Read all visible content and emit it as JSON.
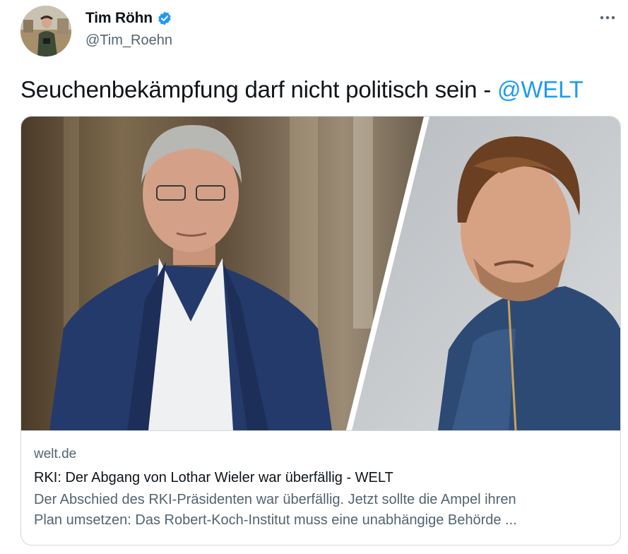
{
  "author": {
    "display_name": "Tim Röhn",
    "handle": "@Tim_Roehn",
    "verified_icon": "verified-badge-icon",
    "avatar_icon": "avatar"
  },
  "tweet": {
    "text": "Seuchenbekämpfung darf nicht politisch sein - ",
    "mention": "@WELT"
  },
  "card": {
    "domain": "welt.de",
    "title": "RKI: Der Abgang von Lothar Wieler war überfällig - WELT",
    "description_line1": "Der Abschied des RKI-Präsidenten war überfällig. Jetzt sollte die Ampel ihren",
    "description_line2": "Plan umsetzen: Das Robert-Koch-Institut muss eine unabhängige Behörde ..."
  },
  "colors": {
    "accent": "#1d9bf0",
    "text_primary": "#0f1419",
    "text_secondary": "#536471",
    "border": "#cfd9de"
  },
  "icons": {
    "more": "more-options-icon"
  }
}
